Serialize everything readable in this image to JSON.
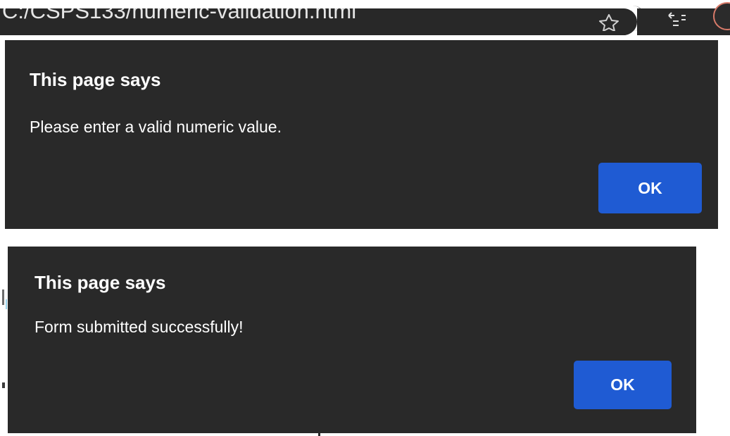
{
  "browser": {
    "url_text": "C:/CSPS133/numeric-validation.html"
  },
  "dialogs": [
    {
      "title": "This page says",
      "message": "Please enter a valid numeric value.",
      "ok_label": "OK"
    },
    {
      "title": "This page says",
      "message": "Form submitted successfully!",
      "ok_label": "OK"
    }
  ],
  "icons": {
    "bookmark": "star-icon",
    "reading_list": "reading-list-icon",
    "profile": "avatar"
  },
  "colors": {
    "dialog_background": "#292929",
    "ok_button": "#1f5bd3",
    "text": "#ffffff"
  }
}
